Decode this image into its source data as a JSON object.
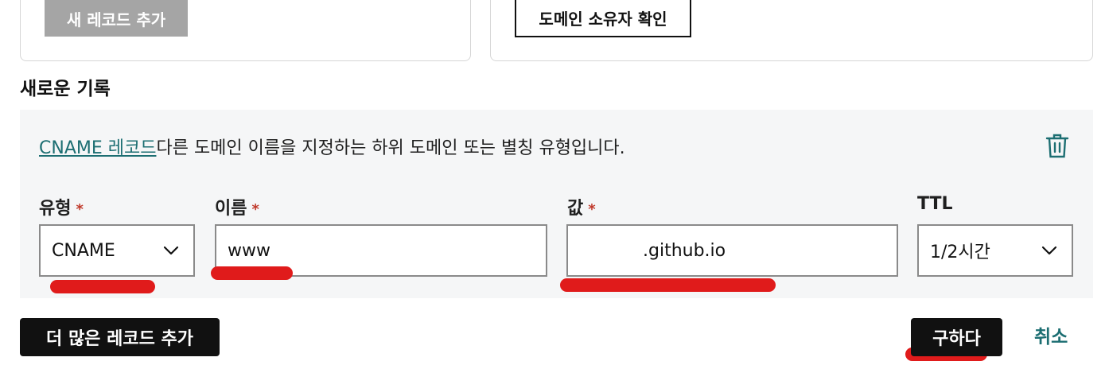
{
  "top": {
    "add_record_label": "새 레코드 추가",
    "verify_owner_label": "도메인 소유자 확인"
  },
  "section": {
    "title": "새로운 기록"
  },
  "record": {
    "type_link": "CNAME 레코드",
    "description": "다른 도메인 이름을 지정하는 하위 도메인 또는 별칭 유형입니다.",
    "fields": {
      "type": {
        "label": "유형",
        "required": "*",
        "value": "CNAME"
      },
      "name": {
        "label": "이름",
        "required": "*",
        "value": "www"
      },
      "value": {
        "label": "값",
        "required": "*",
        "value": ".github.io"
      },
      "ttl": {
        "label": "TTL",
        "value": "1/2시간"
      }
    }
  },
  "actions": {
    "add_more_label": "더 많은 레코드 추가",
    "save_label": "구하다",
    "cancel_label": "취소"
  },
  "colors": {
    "accent": "#1c6e72",
    "annotation_red": "#e01b1b",
    "required": "#c0392b",
    "panel_bg": "#f5f6f7"
  }
}
